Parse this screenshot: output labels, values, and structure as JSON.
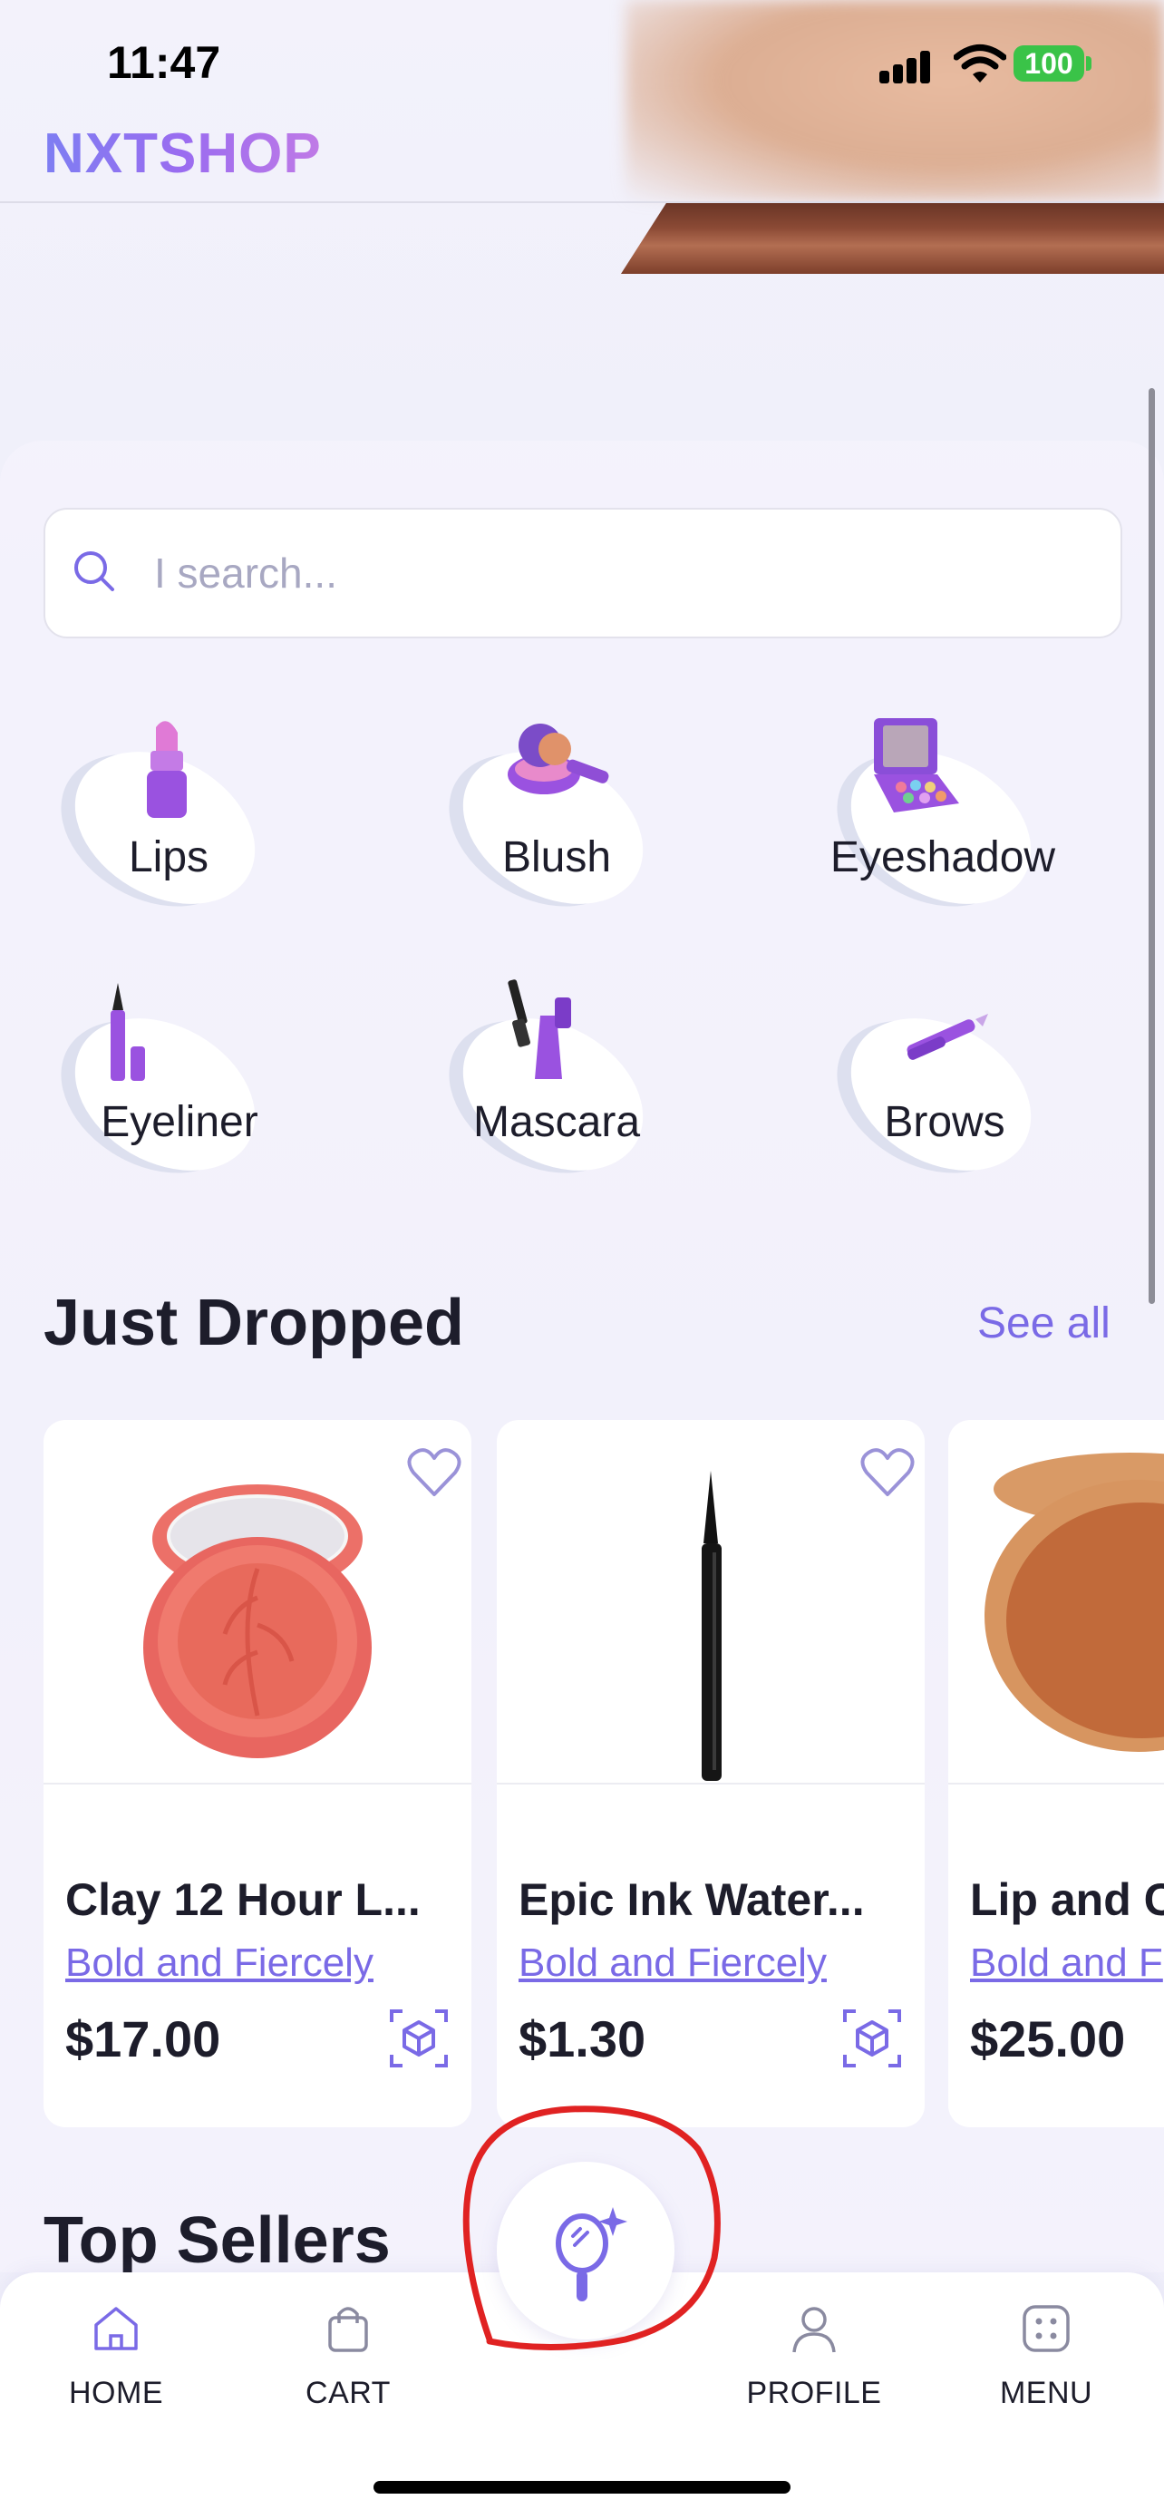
{
  "status_bar": {
    "time": "11:47",
    "battery": "100"
  },
  "header": {
    "brand": "NXTSHOP"
  },
  "search": {
    "placeholder": "I search..."
  },
  "categories": [
    {
      "label": "Lips",
      "icon": "lipstick-icon"
    },
    {
      "label": "Blush",
      "icon": "blush-icon"
    },
    {
      "label": "Eyeshadow",
      "icon": "eyeshadow-palette-icon"
    },
    {
      "label": "Eyeliner",
      "icon": "eyeliner-icon"
    },
    {
      "label": "Mascara",
      "icon": "mascara-icon"
    },
    {
      "label": "Brows",
      "icon": "brow-pencil-icon"
    }
  ],
  "just_dropped": {
    "title": "Just Dropped",
    "see_all": "See all",
    "products": [
      {
        "name": "Clay 12 Hour L...",
        "brand": "Bold and Fiercely",
        "price": "$17.00"
      },
      {
        "name": "Epic Ink Water...",
        "brand": "Bold and Fiercely",
        "price": "$1.30"
      },
      {
        "name": "Lip and C",
        "brand": "Bold and F",
        "price": "$25.00"
      }
    ]
  },
  "top_sellers": {
    "title": "Top Sellers"
  },
  "bottom_nav": {
    "items": [
      {
        "label": "HOME",
        "icon": "home-icon"
      },
      {
        "label": "CART",
        "icon": "bag-icon"
      },
      {
        "label": "PROFILE",
        "icon": "person-icon"
      },
      {
        "label": "MENU",
        "icon": "grid-dots-icon"
      }
    ],
    "center_icon": "magic-mirror-icon"
  },
  "colors": {
    "accent": "#7a6ae6",
    "annotation": "#e02222",
    "battery": "#3ac348"
  }
}
